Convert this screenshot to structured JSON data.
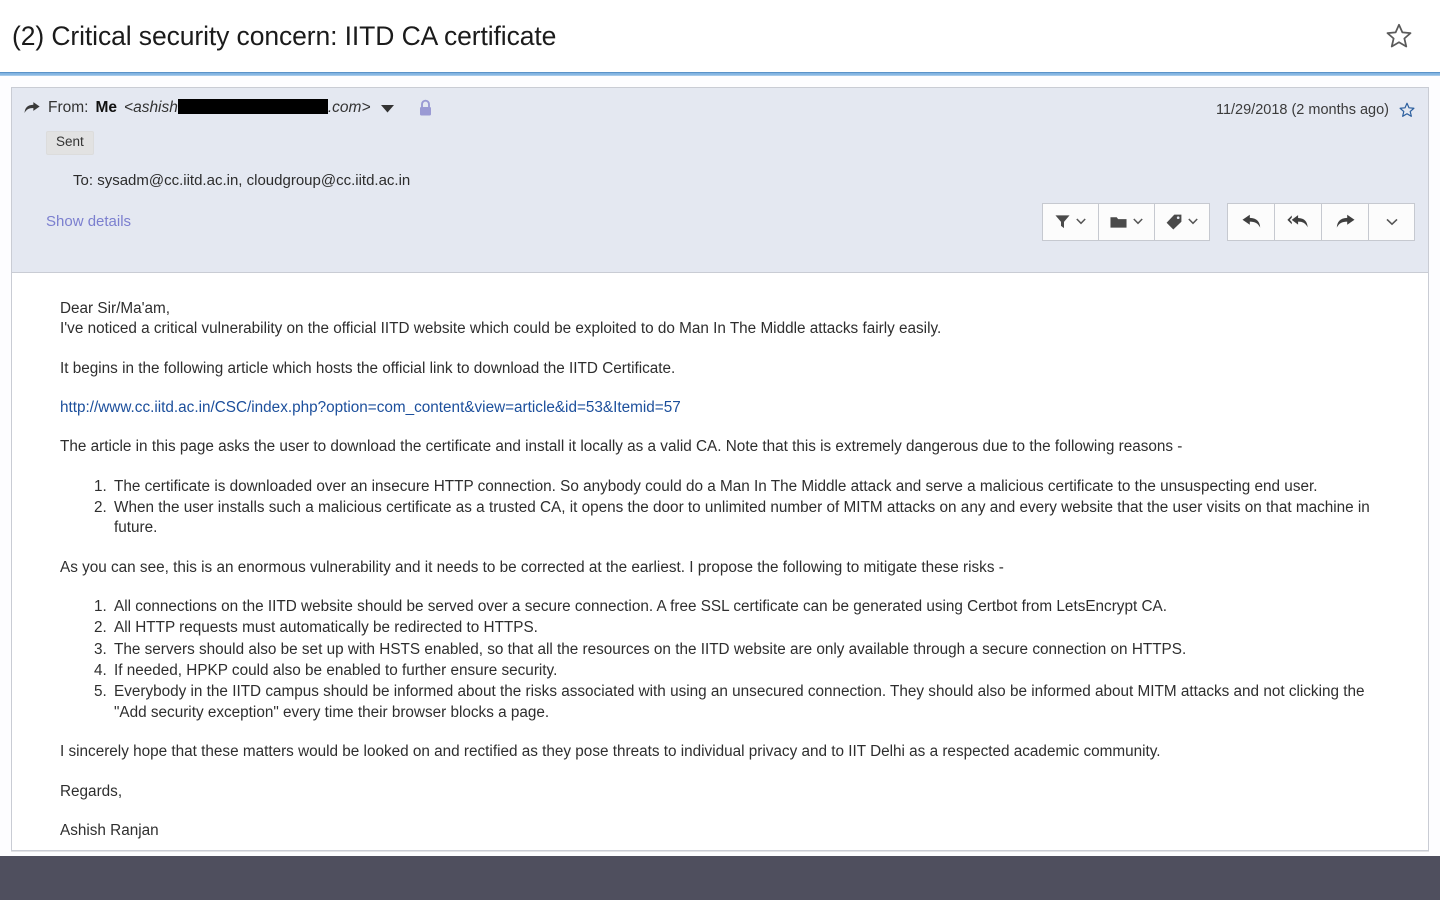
{
  "header": {
    "subject": "(2) Critical security concern: IITD CA certificate",
    "star_icon": "star-outline-icon"
  },
  "message": {
    "forward_icon": "forward-arrow-icon",
    "from_label": "From:",
    "from_name": "Me",
    "from_address_prefix": "<ashish",
    "from_address_suffix": ".com>",
    "from_caret_icon": "chevron-down-icon",
    "encryption_icon": "lock-icon",
    "date": "11/29/2018 (2 months ago)",
    "date_star_icon": "star-outline-icon",
    "folder_badge": "Sent",
    "to_label": "To:",
    "to_recipients": "sysadm@cc.iitd.ac.in, cloudgroup@cc.iitd.ac.in",
    "show_details": "Show details"
  },
  "toolbar": {
    "buttons": [
      {
        "name": "filter-button",
        "icon": "funnel-icon",
        "caret": true
      },
      {
        "name": "move-to-folder-button",
        "icon": "folder-icon",
        "caret": true
      },
      {
        "name": "tag-button",
        "icon": "tag-icon",
        "caret": true
      },
      {
        "name": "reply-button",
        "icon": "reply-arrow-icon",
        "caret": false
      },
      {
        "name": "reply-all-button",
        "icon": "reply-all-arrow-icon",
        "caret": false
      },
      {
        "name": "forward-button",
        "icon": "forward-arrow-icon",
        "caret": false
      },
      {
        "name": "more-actions-button",
        "icon": "chevron-down-icon",
        "caret": false
      }
    ]
  },
  "body": {
    "salutation": "Dear Sir/Ma'am,",
    "intro": "I've noticed a critical vulnerability on the official IITD website which could be exploited to do Man In The Middle attacks fairly easily.",
    "para_article": "It begins in the following article which hosts the official link to download the IITD Certificate.",
    "link_url": "http://www.cc.iitd.ac.in/CSC/index.php?option=com_content&view=article&id=53&Itemid=57",
    "para_reasons_lead": "The article in this page asks the user to download the certificate and install it locally as a valid CA. Note that this is extremely dangerous due to the following reasons -",
    "reasons": [
      "The certificate is downloaded over an insecure HTTP connection. So anybody could do a Man In The Middle attack and serve a malicious certificate to the unsuspecting end user.",
      "When the user installs such a malicious certificate as a trusted CA, it opens the door to unlimited number of MITM attacks on any and every website that the user visits on that machine in future."
    ],
    "para_proposal_lead": "As you can see, this is an enormous vulnerability and it needs to be corrected at the earliest. I propose the following to mitigate these risks -",
    "proposals": [
      "All connections on the IITD website should be served over a secure connection. A free SSL certificate can be generated using Certbot from LetsEncrypt CA.",
      "All HTTP requests must automatically be redirected to HTTPS.",
      "The servers should also be set up with HSTS enabled, so that all the resources on the IITD website are only available through a secure connection on HTTPS.",
      "If needed, HPKP could also be enabled to further ensure security.",
      "Everybody in the IITD campus should be informed about the risks associated with using an unsecured connection. They should also be informed about MITM attacks and not clicking the \"Add security exception\" every time their browser blocks a page."
    ],
    "closing": "I sincerely hope that these matters would be looked on and rectified as they pose threats to individual privacy and to IIT Delhi as a respected academic community.",
    "sign_off": "Regards,",
    "sender_name": "Ashish Ranjan"
  },
  "colors": {
    "link": "#1c4f9c",
    "header_bg": "#e4e8f1",
    "accent_rule": "#7fb2e0",
    "lock": "#9a9ad4",
    "bottom_bar": "#4f4f5e",
    "show_details": "#7b7fcf"
  }
}
